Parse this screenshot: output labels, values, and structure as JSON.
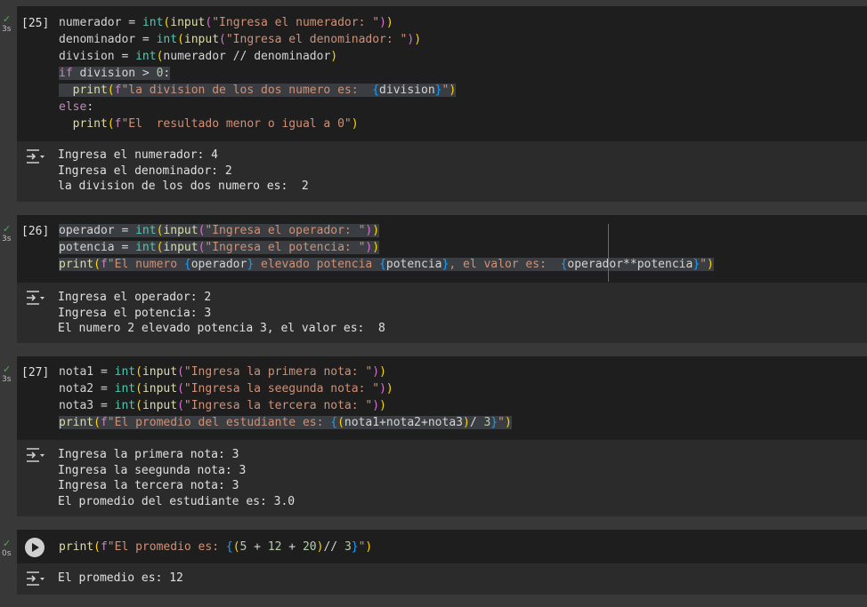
{
  "cells": [
    {
      "count": "[25]",
      "status": "✓",
      "duration": "3s",
      "output": [
        "Ingresa el numerador: 4",
        "Ingresa el denominador: 2",
        "la division de los dos numero es:  2"
      ]
    },
    {
      "count": "[26]",
      "status": "✓",
      "duration": "3s",
      "output": [
        "Ingresa el operador: 2",
        "Ingresa el potencia: 3",
        "El numero 2 elevado potencia 3, el valor es:  8"
      ]
    },
    {
      "count": "[27]",
      "status": "✓",
      "duration": "3s",
      "output": [
        "Ingresa la primera nota: 3",
        "Ingresa la seegunda nota: 3",
        "Ingresa la tercera nota: 3",
        "El promedio del estudiante es: 3.0"
      ]
    },
    {
      "status": "✓",
      "duration": "0s",
      "output": [
        "El promedio es: 12"
      ]
    }
  ],
  "code": {
    "c25": {
      "v_numerador": "numerador",
      "v_denominador": "denominador",
      "v_division": "division",
      "eq": " = ",
      "int": "int",
      "input": "input",
      "s_num": "\"Ingresa el numerador: \"",
      "s_den": "\"Ingresa el denominador: \"",
      "floordiv": " // ",
      "kw_if": "if",
      "gt0": " > ",
      "zero": "0",
      "colon": ":",
      "print": "print",
      "f": "f",
      "s_div_a": "\"la division de los dos numero es:  ",
      "s_end": "\"",
      "kw_else": "else",
      "s_else": "\"El  resultado menor o igual a 0\""
    },
    "c26": {
      "v_operador": "operador",
      "v_potencia": "potencia",
      "s_op": "\"Ingresa el operador: \"",
      "s_pot": "\"Ingresa el potencia: \"",
      "s_a": "\"El numero ",
      "s_b": " elevado potencia ",
      "s_c": ", el valor es:  ",
      "pow": "**"
    },
    "c27": {
      "v_nota1": "nota1",
      "v_nota2": "nota2",
      "v_nota3": "nota3",
      "s_n1": "\"Ingresa la primera nota: \"",
      "s_n2": "\"Ingresa la seegunda nota: \"",
      "s_n3": "\"Ingresa la tercera nota: \"",
      "s_a": "\"El promedio del estudiante es: ",
      "plus": "+",
      "div3": "/ ",
      "three": "3"
    },
    "c28": {
      "s_a": "\"El promedio es: ",
      "five": "5",
      "twelve": "12",
      "twenty": "20",
      "plus": " + ",
      "fdiv": "// ",
      "three": "3"
    }
  }
}
